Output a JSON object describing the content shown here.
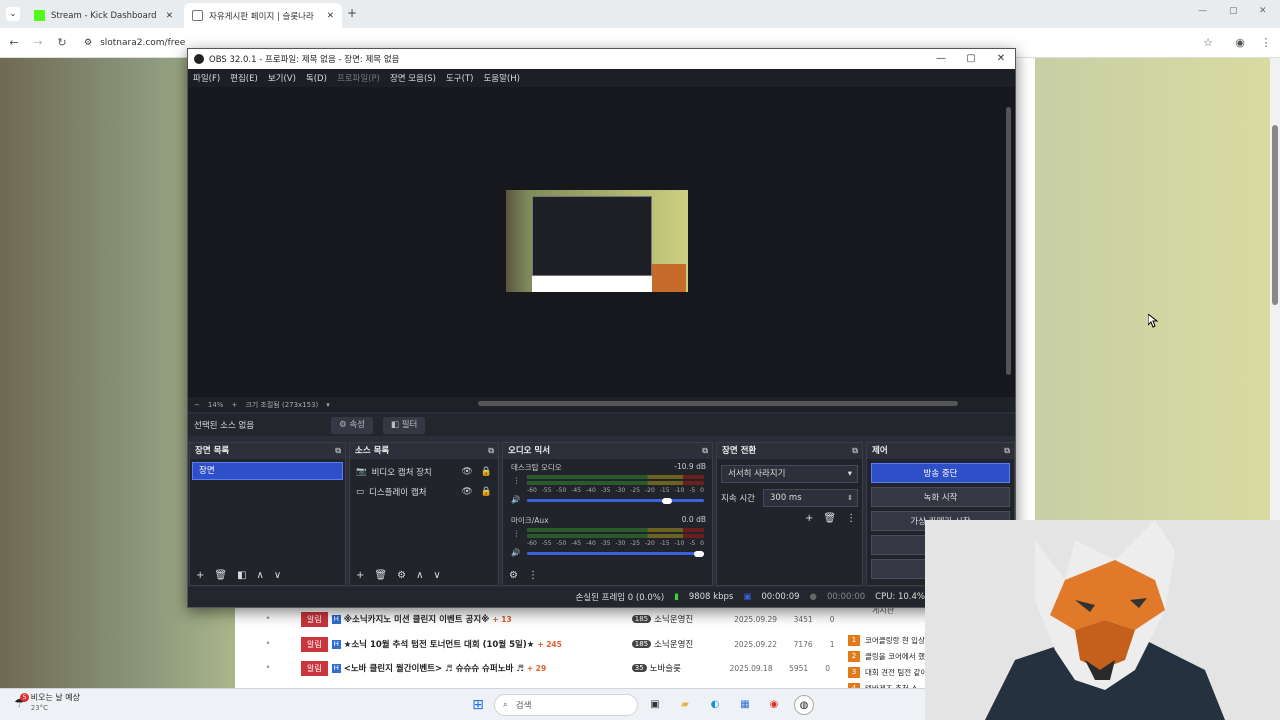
{
  "browser": {
    "tabs": [
      {
        "label": "Stream - Kick Dashboard"
      },
      {
        "label": "자유게시판 페이지 | 슬롯나라"
      }
    ],
    "new_tab": "+",
    "address": "slotnara2.com/free",
    "window_controls": [
      "—",
      "▢",
      "✕"
    ]
  },
  "obs": {
    "title": "OBS 32.0.1 - 프로파일: 제목 없음 - 장면: 제목 없음",
    "menu": [
      "파일(F)",
      "편집(E)",
      "보기(V)",
      "독(D)",
      "프로파일(P)",
      "장면 모음(S)",
      "도구(T)",
      "도움말(H)"
    ],
    "zoom": {
      "minus": "−",
      "percent": "14%",
      "plus": "+",
      "label": "크기 조절됨 (273x153)"
    },
    "selected_source": "선택된 소스 없음",
    "properties_btn": "속성",
    "filters_btn": "필터",
    "docks": {
      "scenes": {
        "title": "장면 목록",
        "items": [
          "장면"
        ]
      },
      "sources": {
        "title": "소스 목록",
        "items": [
          "비디오 캡처 장치",
          "디스플레이 캡처"
        ]
      },
      "mixer": {
        "title": "오디오 믹서",
        "channels": [
          {
            "name": "데스크탑 오디오",
            "db": "-10.9 dB",
            "volume": 0.82
          },
          {
            "name": "마이크/Aux",
            "db": "0.0 dB",
            "volume": 1.0
          }
        ],
        "scale": [
          "-60",
          "-55",
          "-50",
          "-45",
          "-40",
          "-35",
          "-30",
          "-25",
          "-20",
          "-15",
          "-10",
          "-5",
          "0"
        ]
      },
      "transitions": {
        "title": "장면 전환",
        "type": "서서히 사라지기",
        "duration_label": "지속 시간",
        "duration": "300 ms"
      },
      "controls": {
        "title": "제어",
        "buttons": [
          "방송 중단",
          "녹화 시작",
          "가상 카메라 시작",
          "스",
          ""
        ]
      }
    },
    "status": {
      "dropped": "손실된 프레임 0 (0.0%)",
      "bitrate": "9808 kbps",
      "stream_time": "00:00:09",
      "rec_time": "00:00:00",
      "cpu": "CPU: 10.4%"
    }
  },
  "board": {
    "rows": [
      {
        "tag": "알림",
        "title": "※소닉카지노 미션 클린지 이벤트 공지※",
        "count": "+ 13",
        "level": "185",
        "author": "소닉운영진",
        "date": "2025.09.29",
        "views": "3451",
        "likes": "0"
      },
      {
        "tag": "알림",
        "title": "★소닉 10월 추석 텀전 토너먼트 대회 (10월 5일)★",
        "count": "+ 245",
        "level": "185",
        "author": "소닉운영진",
        "date": "2025.09.22",
        "views": "7176",
        "likes": "1"
      },
      {
        "tag": "알림",
        "title": "<노바 클린지 월간이벤트> ♬ 슈슈슈 슈퍼노바 ♬",
        "count": "+ 29",
        "level": "35",
        "author": "노바슬롯",
        "date": "2025.09.18",
        "views": "5951",
        "likes": "0"
      }
    ],
    "side_title": "게시판",
    "rank_items": [
      {
        "n": "1",
        "t": "코어클링랑 현 입상"
      },
      {
        "n": "2",
        "t": "클링을 코어에서 했"
      },
      {
        "n": "3",
        "t": "대회 견전 팀전 같아"
      },
      {
        "n": "4",
        "t": "텐바겐즈 추천 스"
      }
    ]
  },
  "taskbar": {
    "weather_badge": "5",
    "weather": "비오는 날 예상",
    "temp": "23°C",
    "search": "검색"
  },
  "colors": {
    "obs_accent": "#2f4fc9",
    "board_tag": "#c9363e",
    "rank": "#e07b1a"
  }
}
